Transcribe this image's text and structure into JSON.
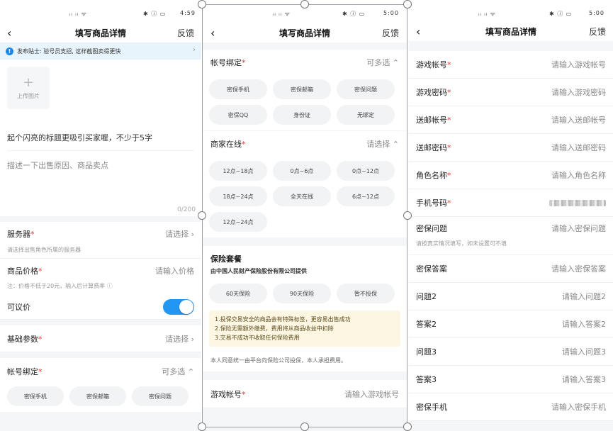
{
  "status": {
    "signal_left": "⁴⁶ᵢₗ ᵢₗ ᯤ",
    "right_icons": "✱ ⁱ ⅡI ▭",
    "time1": "4:59",
    "time2": "5:00",
    "time3": "5:00"
  },
  "nav": {
    "title": "填写商品详情",
    "feedback": "反馈"
  },
  "p1": {
    "tip": "发布贴士: 验号员支招, 这样截图卖得更快",
    "upload": "上传图片",
    "title_placeholder": "起个闪亮的标题更吸引买家喔，不少于5字",
    "desc_placeholder": "描述一下出售原因、商品卖点",
    "counter": "0/200",
    "server_label": "服务器",
    "server_value": "请选择 ›",
    "server_hint": "请选择出售角色所属的服务器",
    "price_label": "商品价格",
    "price_value": "请输入价格",
    "price_hint": "注：价格不低于20元，输入后计算费率 ⓘ",
    "negotiable_label": "可议价",
    "base_label": "基础参数",
    "base_value": "请选择 ›",
    "bind_label": "帐号绑定",
    "bind_value": "可多选 ⌃",
    "bind_chips": [
      "密保手机",
      "密保邮箱",
      "密保问题"
    ]
  },
  "p2": {
    "bind_label": "帐号绑定",
    "bind_value": "可多选 ⌃",
    "bind_chips": [
      "密保手机",
      "密保邮箱",
      "密保问题",
      "密保QQ",
      "身份证",
      "无绑定"
    ],
    "online_label": "商家在线",
    "online_value": "请选择 ⌃",
    "online_chips": [
      "12点~18点",
      "0点~6点",
      "0点~12点",
      "18点~24点",
      "全天在线",
      "6点~12点",
      "12点~24点"
    ],
    "ins_title": "保险套餐",
    "ins_sub": "由中国人民财产保险股份有限公司提供",
    "ins_chips": [
      "60天保险",
      "90天保险",
      "暂不投保"
    ],
    "ins_notes": [
      "1.投保交易安全的商品会有特殊标签，更容易出售成功",
      "2.保险无需额外缴费，费用将从商品收益中扣除",
      "3.交易不成功不收取任何保险费用"
    ],
    "agree": "本人同意统一由平台向保险公司投保，本人承担费用。",
    "account_label": "游戏帐号",
    "account_value": "请输入游戏帐号"
  },
  "p3": {
    "rows": [
      {
        "label": "游戏帐号",
        "req": "*",
        "value": "请输入游戏帐号"
      },
      {
        "label": "游戏密码",
        "req": "*",
        "value": "请输入游戏密码"
      },
      {
        "label": "送邮帐号",
        "req": "*",
        "value": "请输入送邮帐号"
      },
      {
        "label": "送邮密码",
        "req": "*",
        "value": "请输入送邮密码"
      },
      {
        "label": "角色名称",
        "req": "*",
        "value": "请输入角色名称"
      },
      {
        "label": "手机号码",
        "req": "*",
        "value": ""
      },
      {
        "label": "密保问题",
        "req": "",
        "value": "请输入密保问题"
      },
      {
        "label": "密保答案",
        "req": "",
        "value": "请输入密保答案"
      },
      {
        "label": "问题2",
        "req": "",
        "value": "请输入问题2"
      },
      {
        "label": "答案2",
        "req": "",
        "value": "请输入答案2"
      },
      {
        "label": "问题3",
        "req": "",
        "value": "请输入问题3"
      },
      {
        "label": "答案3",
        "req": "",
        "value": "请输入答案3"
      },
      {
        "label": "密保手机",
        "req": "",
        "value": "请输入密保手机"
      }
    ],
    "question_hint": "请按真实情况填写，如未设置可不填"
  },
  "colors": {
    "accent": "#2196f3",
    "required": "#e53935",
    "tip_bg": "#e8f4fc",
    "note_bg": "#fdf6e3"
  }
}
